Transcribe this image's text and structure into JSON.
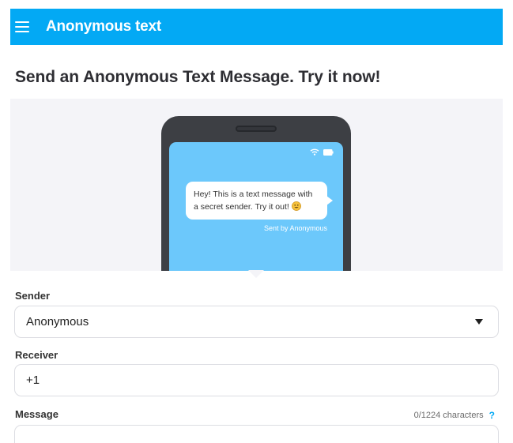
{
  "app": {
    "title": "Anonymous text"
  },
  "headline": "Send an Anonymous Text Message. Try it now!",
  "preview": {
    "bubble_text": "Hey! This is a text message with a secret sender. Try it out!",
    "sent_by": "Sent by Anonymous"
  },
  "form": {
    "sender_label": "Sender",
    "sender_value": "Anonymous",
    "receiver_label": "Receiver",
    "receiver_value": "+1",
    "message_label": "Message",
    "message_counter": "0/1224 characters",
    "help_symbol": "?"
  },
  "icons": [
    "menu-icon",
    "wifi-icon",
    "battery-icon",
    "smile-emoji-icon",
    "dropdown-caret-icon",
    "help-icon"
  ],
  "colors": {
    "accent": "#03a9f4",
    "screen": "#6cc8fb",
    "stage": "#f4f4f8"
  }
}
